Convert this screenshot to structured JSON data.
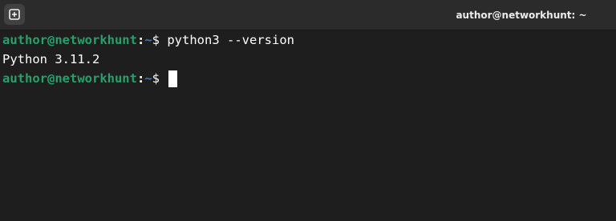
{
  "window": {
    "title": "author@networkhunt: ~",
    "new_tab_icon": "new-tab-icon"
  },
  "terminal": {
    "prompt": {
      "user_host": "author@networkhunt",
      "separator": ":",
      "dir": "~",
      "symbol": "$ "
    },
    "lines": [
      {
        "type": "command",
        "command": "python3 --version"
      },
      {
        "type": "output",
        "text": "Python 3.11.2"
      },
      {
        "type": "prompt",
        "command": ""
      }
    ]
  },
  "colors": {
    "background": "#1e1e1e",
    "titlebar": "#2b2b2b",
    "prompt_user": "#26a269",
    "prompt_dir": "#3b74b8",
    "text": "#ffffff"
  }
}
